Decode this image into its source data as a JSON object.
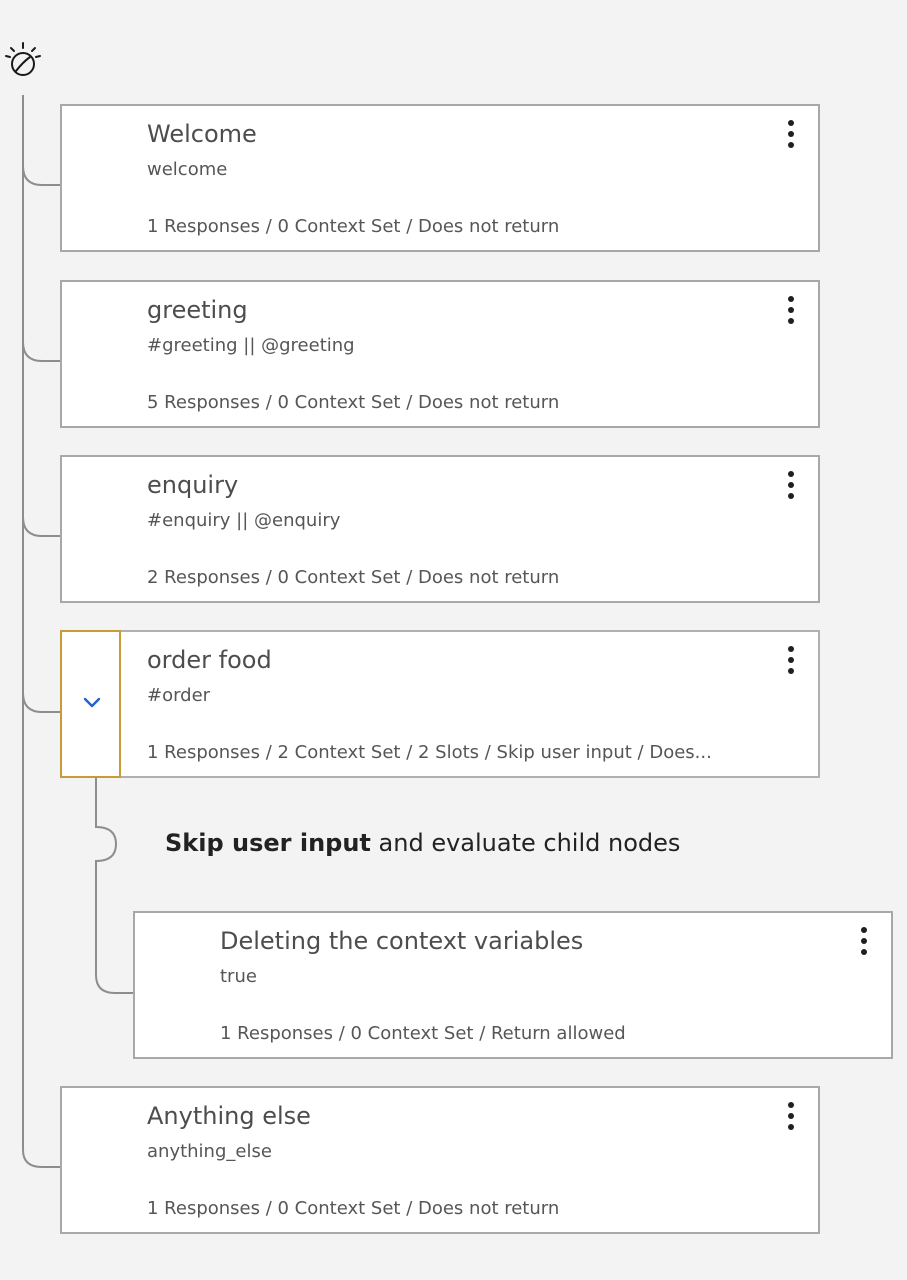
{
  "icons": {
    "logo": "lightbulb-logo-icon",
    "menu": "overflow-menu-icon",
    "expand": "chevron-down-icon"
  },
  "colors": {
    "selected_border": "#c99a3a",
    "chevron": "#1f63d1",
    "tree_line": "#8d8d8d"
  },
  "nodes": [
    {
      "title": "Welcome",
      "condition": "welcome",
      "summary": "1 Responses / 0 Context Set / Does not return"
    },
    {
      "title": "greeting",
      "condition": "#greeting || @greeting",
      "summary": "5 Responses / 0 Context Set / Does not return"
    },
    {
      "title": "enquiry",
      "condition": "#enquiry || @enquiry",
      "summary": "2 Responses / 0 Context Set / Does not return"
    },
    {
      "title": "order food",
      "condition": "#order",
      "summary": "1 Responses / 2 Context Set / 2 Slots / Skip user input / Does..."
    },
    {
      "title": "Deleting the context variables",
      "condition": "true",
      "summary": "1 Responses / 0 Context Set / Return allowed"
    },
    {
      "title": "Anything else",
      "condition": "anything_else",
      "summary": "1 Responses / 0 Context Set / Does not return"
    }
  ],
  "skip_note": {
    "bold": "Skip user input",
    "rest": " and evaluate child nodes"
  }
}
